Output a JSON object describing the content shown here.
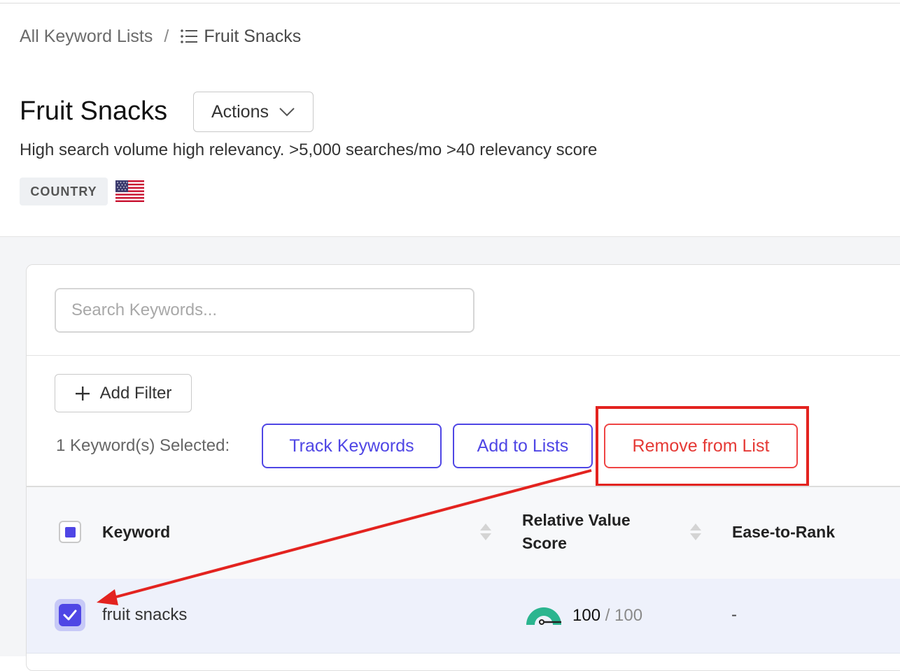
{
  "breadcrumb": {
    "root": "All Keyword Lists",
    "separator": "/",
    "current": "Fruit Snacks",
    "current_icon": "list-icon"
  },
  "header": {
    "title": "Fruit Snacks",
    "actions_label": "Actions",
    "actions_icon": "chevron-down-icon",
    "description": "High search volume high relevancy. >5,000 searches/mo >40 relevancy score",
    "country_badge": "COUNTRY",
    "country_flag": "us-flag-icon"
  },
  "search": {
    "placeholder": "Search Keywords...",
    "value": ""
  },
  "filters": {
    "add_filter_label": "Add Filter",
    "add_icon": "plus-icon"
  },
  "selection": {
    "text": "1 Keyword(s) Selected:",
    "track_label": "Track Keywords",
    "add_to_lists_label": "Add to Lists",
    "remove_label": "Remove from List"
  },
  "table": {
    "columns": [
      {
        "label": "Keyword"
      },
      {
        "label": "Relative Value Score"
      },
      {
        "label": "Ease-to-Rank"
      }
    ],
    "rows": [
      {
        "keyword": "fruit snacks",
        "score": "100",
        "score_max": "/ 100",
        "score_fraction": 1.0,
        "ease": "-",
        "selected": true
      }
    ]
  },
  "colors": {
    "accent": "#4f46e5",
    "danger": "#e53935",
    "gauge": "#2bb58f",
    "annotation": "#e3231f"
  }
}
